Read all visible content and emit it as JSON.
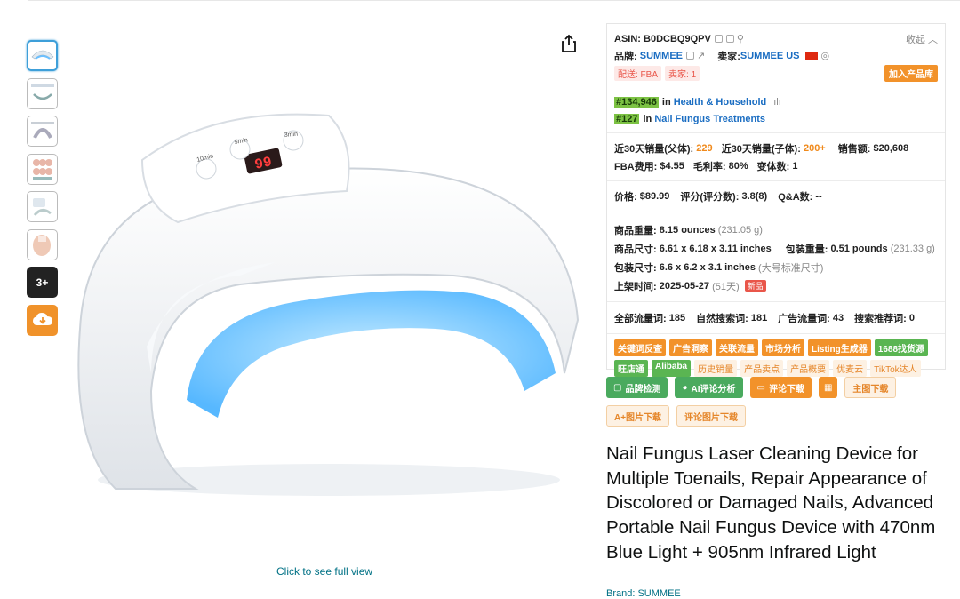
{
  "thumbnails": {
    "more_label": "3+"
  },
  "main": {
    "full_view_link": "Click to see full view"
  },
  "panel": {
    "asin_label": "ASIN:",
    "asin": "B0DCBQ9QPV",
    "collapse": "收起",
    "brand_label": "品牌:",
    "brand": "SUMMEE",
    "seller_label": "卖家:",
    "seller": "SUMMEE US",
    "fulfillment": "配送: FBA",
    "seller_count": "卖家: 1",
    "add_library": "加入产品库",
    "rank1_num": "#134,946",
    "rank1_in": "in",
    "rank1_cat": "Health & Household",
    "rank2_num": "#127",
    "rank2_in": "in",
    "rank2_cat": "Nail Fungus Treatments",
    "sales_parent_label": "近30天销量(父体):",
    "sales_parent": "229",
    "sales_child_label": "近30天销量(子体):",
    "sales_child": "200+",
    "revenue_label": "销售额:",
    "revenue": "$20,608",
    "fba_label": "FBA费用:",
    "fba": "$4.55",
    "margin_label": "毛利率:",
    "margin": "80%",
    "variants_label": "变体数:",
    "variants": "1",
    "price_label": "价格:",
    "price": "$89.99",
    "rating_label": "评分(评分数):",
    "rating": "3.8(8)",
    "qa_label": "Q&A数:",
    "qa": "--",
    "weight_label": "商品重量:",
    "weight": "8.15 ounces",
    "weight_g": "(231.05 g)",
    "dims_label": "商品尺寸:",
    "dims": "6.61 x 6.18 x 3.11 inches",
    "pkg_weight_label": "包装重量:",
    "pkg_weight": "0.51 pounds",
    "pkg_weight_g": "(231.33 g)",
    "pkg_dims_label": "包装尺寸:",
    "pkg_dims": "6.6 x 6.2 x 3.1 inches",
    "pkg_size_class": "(大号标准尺寸)",
    "listed_label": "上架时间:",
    "listed": "2025-05-27",
    "listed_days": "(51天)",
    "new_tag": "新品",
    "traffic_all_label": "全部流量词:",
    "traffic_all": "185",
    "organic_label": "自然搜索词:",
    "organic": "181",
    "ad_label": "广告流量词:",
    "ad": "43",
    "rec_label": "搜索推荐词:",
    "rec": "0",
    "tags": [
      {
        "label": "关键词反查",
        "style": "o"
      },
      {
        "label": "广告洞察",
        "style": "o"
      },
      {
        "label": "关联流量",
        "style": "o"
      },
      {
        "label": "市场分析",
        "style": "o"
      },
      {
        "label": "Listing生成器",
        "style": "o"
      },
      {
        "label": "1688找货源",
        "style": "g"
      },
      {
        "label": "旺店通",
        "style": "g"
      },
      {
        "label": "Alibaba",
        "style": "g"
      },
      {
        "label": "历史销量",
        "style": "l"
      },
      {
        "label": "产品卖点",
        "style": "l"
      },
      {
        "label": "产品概要",
        "style": "l"
      },
      {
        "label": "优麦云",
        "style": "l"
      },
      {
        "label": "TikTok达人",
        "style": "l"
      }
    ]
  },
  "actions": {
    "brand_check": "品牌检测",
    "ai_review": "AI评论分析",
    "review_download": "评论下载",
    "main_image_download": "主图下载",
    "aplus_download": "A+图片下载",
    "review_image_download": "评论图片下载"
  },
  "product": {
    "title": "Nail Fungus Laser Cleaning Device for Multiple Toenails, Repair Appearance of Discolored or Damaged Nails, Advanced Portable Nail Fungus Device with 470nm Blue Light + 905nm Infrared Light",
    "brand_line": "Brand: SUMMEE"
  },
  "device": {
    "display": "99",
    "btn1": "10min",
    "btn2": "5min",
    "btn3": "3min"
  }
}
